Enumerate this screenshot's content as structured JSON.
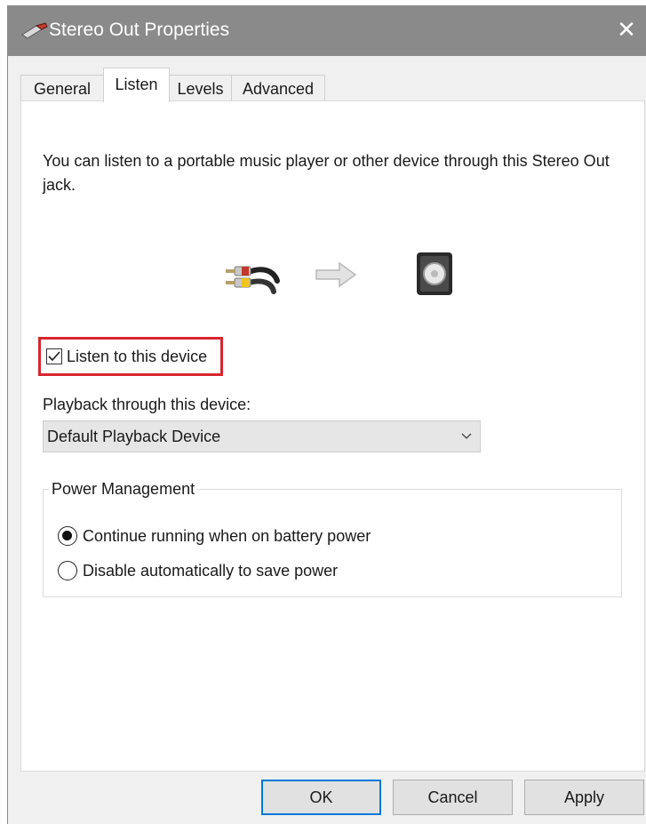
{
  "window": {
    "title": "Stereo Out Properties",
    "close_glyph": "✕",
    "titlebar_color": "#8a8a8a"
  },
  "tabs": [
    {
      "label": "General",
      "active": false
    },
    {
      "label": "Listen",
      "active": true
    },
    {
      "label": "Levels",
      "active": false
    },
    {
      "label": "Advanced",
      "active": false
    }
  ],
  "listen": {
    "description": "You can listen to a portable music player or other device through this Stereo Out jack.",
    "illustration_icons": [
      "rca-cable-icon",
      "right-arrow-icon",
      "speaker-icon"
    ],
    "listen_checkbox": {
      "label": "Listen to this device",
      "checked": true,
      "highlight_color": "#d7262e"
    },
    "playback_label": "Playback through this device:",
    "playback_device": "Default Playback Device",
    "power_management": {
      "title": "Power Management",
      "options": [
        {
          "label": "Continue running when on battery power",
          "selected": true
        },
        {
          "label": "Disable automatically to save power",
          "selected": false
        }
      ]
    }
  },
  "buttons": {
    "ok": "OK",
    "cancel": "Cancel",
    "apply": "Apply",
    "default_border_color": "#0078d7"
  }
}
